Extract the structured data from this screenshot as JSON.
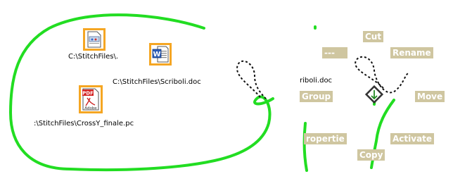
{
  "left_panel": {
    "files": [
      {
        "label": "C:\\StitchFiles\\.",
        "icon": "document-icon"
      },
      {
        "label": "C:\\StitchFiles\\Scriboli.doc",
        "icon": "word-icon"
      },
      {
        "label": ":\\StitchFiles\\CrossY_finale.pc",
        "icon": "pdf-icon"
      }
    ],
    "stroke_color": "#22dd22",
    "selection_color": "#f5a623"
  },
  "right_panel": {
    "partial_file_label": "riboli.doc",
    "pie_menu": {
      "items": {
        "cut": "Cut",
        "blank": "---",
        "rename": "Rename",
        "group": "Group",
        "move": "Move",
        "properties": "ropertie",
        "activate": "Activate",
        "copy": "Copy"
      },
      "item_color": "#cfc6a0"
    }
  }
}
